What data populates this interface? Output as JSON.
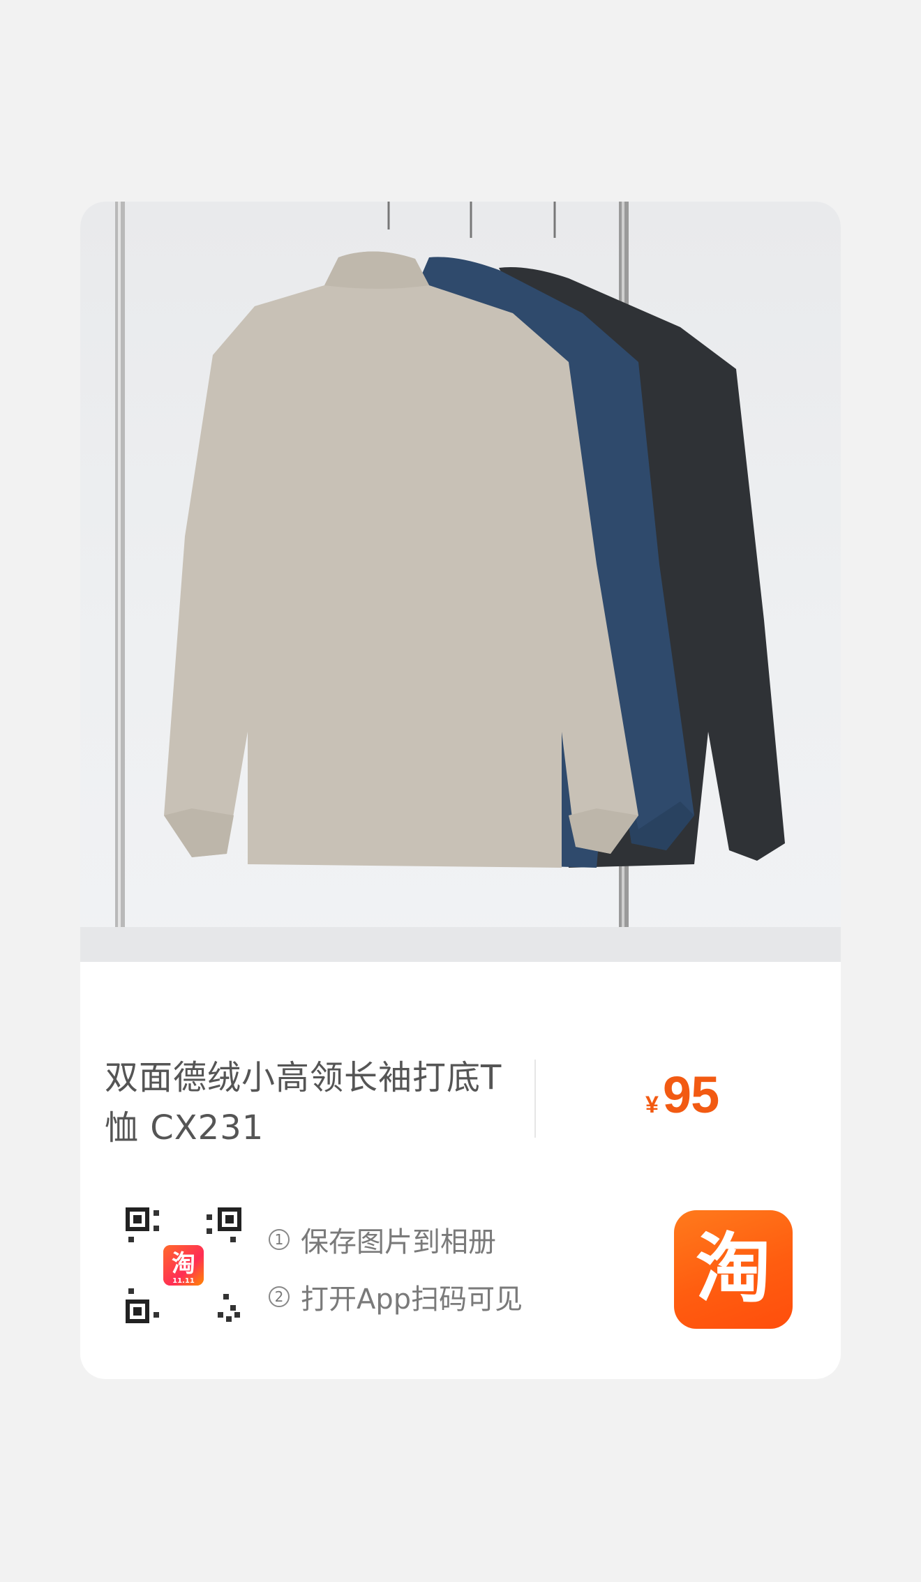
{
  "product": {
    "title": "双面德绒小高领长袖打底T恤 CX231",
    "currency": "¥",
    "price": "95"
  },
  "share": {
    "steps": [
      {
        "num": "1",
        "text": "保存图片到相册"
      },
      {
        "num": "2",
        "text": "打开App扫码可见"
      }
    ],
    "qr_badge_text": "淘",
    "qr_badge_sub": "11.11",
    "app_icon_text": "淘"
  },
  "colors": {
    "accent": "#f25a12",
    "app_icon": "#ff5d10",
    "text": "#555555",
    "muted": "#7a7a7a"
  },
  "icons": {
    "qr": "qr-code-icon",
    "app": "taobao-app-icon",
    "photo": "product-photo"
  }
}
